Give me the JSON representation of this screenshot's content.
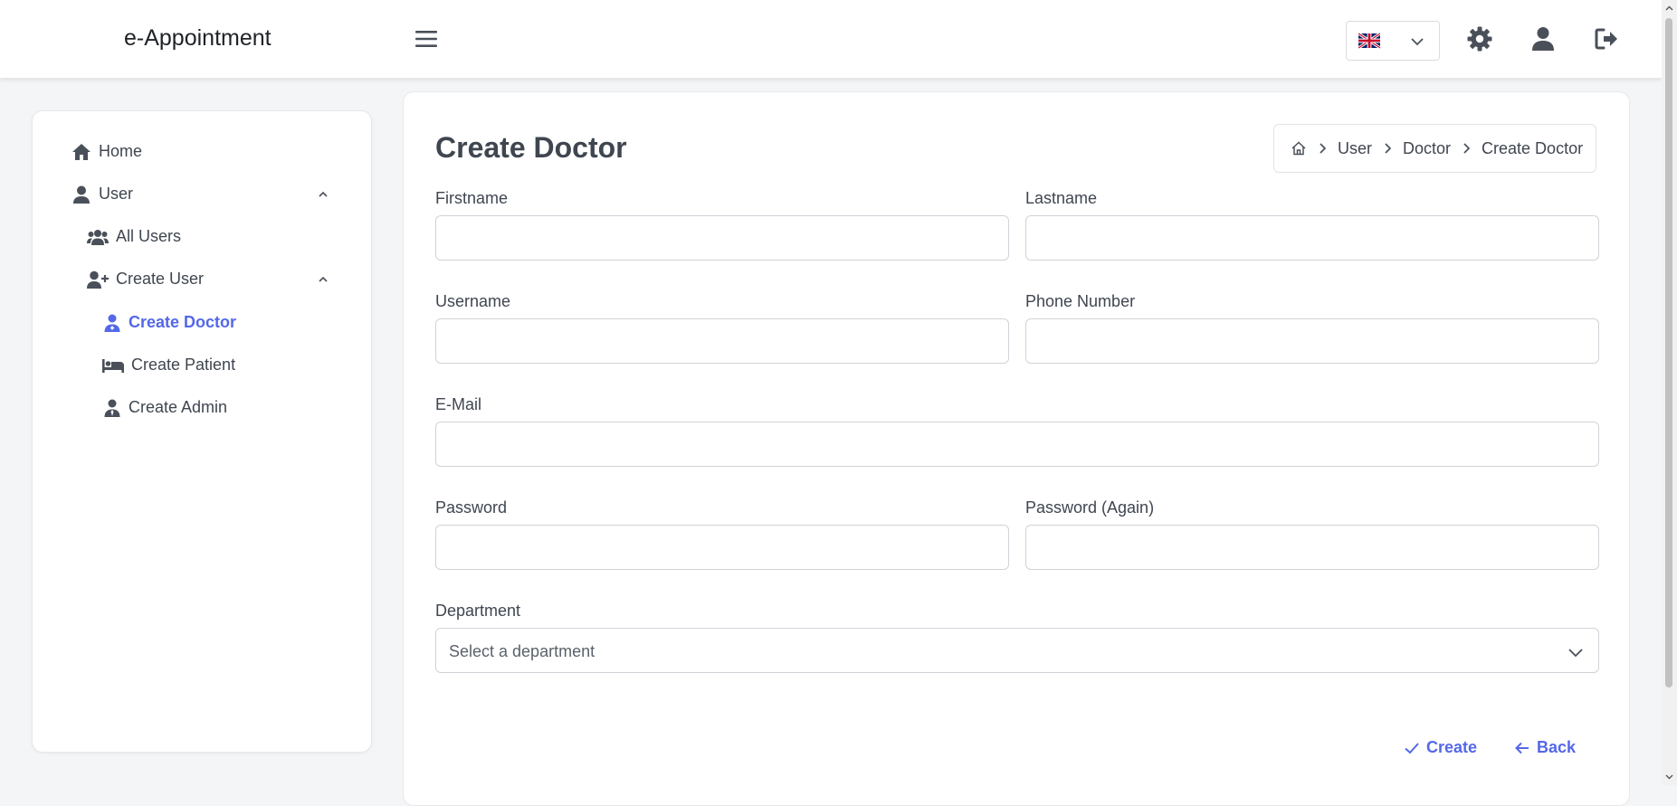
{
  "app": {
    "title": "e-Appointment"
  },
  "topbar": {
    "language": {
      "selected_icon": "uk-flag-icon"
    },
    "icons": [
      "hamburger-icon",
      "gear-icon",
      "user-icon",
      "logout-icon"
    ]
  },
  "sidebar": {
    "home": "Home",
    "user": "User",
    "all_users": "All Users",
    "create_user": "Create User",
    "create_doctor": "Create Doctor",
    "create_patient": "Create Patient",
    "create_admin": "Create Admin"
  },
  "page": {
    "title": "Create Doctor",
    "breadcrumb": [
      "User",
      "Doctor",
      "Create Doctor"
    ]
  },
  "form": {
    "firstname_label": "Firstname",
    "lastname_label": "Lastname",
    "username_label": "Username",
    "phone_label": "Phone Number",
    "email_label": "E-Mail",
    "password_label": "Password",
    "password_again_label": "Password (Again)",
    "department_label": "Department",
    "department_placeholder": "Select a department",
    "firstname_value": "",
    "lastname_value": "",
    "username_value": "",
    "phone_value": "",
    "email_value": "",
    "password_value": "",
    "password_again_value": ""
  },
  "actions": {
    "create": "Create",
    "back": "Back"
  },
  "colors": {
    "accent": "#5468e8",
    "text": "#3f4650",
    "background": "#f4f5f7"
  }
}
